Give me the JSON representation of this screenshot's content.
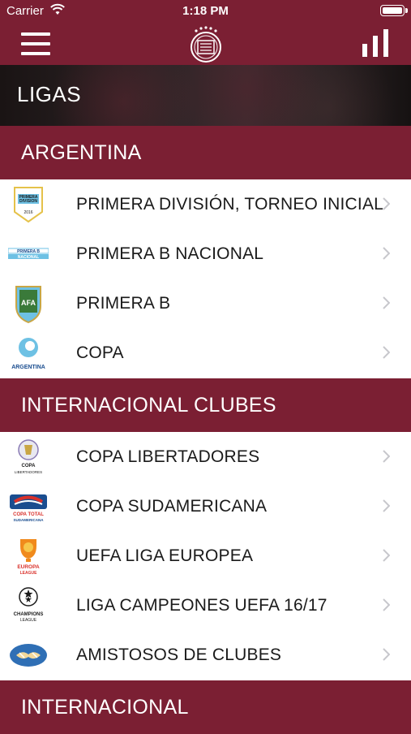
{
  "status_bar": {
    "carrier": "Carrier",
    "time": "1:18 PM"
  },
  "nav": {
    "menu_icon": "hamburger-menu-icon",
    "logo": "club-crest-logo",
    "stats_icon": "bar-chart-icon"
  },
  "hero": {
    "title": "LIGAS"
  },
  "sections": [
    {
      "title": "ARGENTINA",
      "items": [
        {
          "label": "PRIMERA DIVISIÓN, TORNEO INICIAL",
          "logo_text": "PRIMERA DIVISION",
          "logo_sub": "2016"
        },
        {
          "label": "PRIMERA B NACIONAL",
          "logo_text": "PRIMERA B",
          "logo_sub": "NACIONAL"
        },
        {
          "label": "PRIMERA B",
          "logo_text": "AFA",
          "logo_sub": ""
        },
        {
          "label": "COPA",
          "logo_text": "ARGENTINA",
          "logo_sub": ""
        }
      ]
    },
    {
      "title": "INTERNACIONAL CLUBES",
      "items": [
        {
          "label": "COPA LIBERTADORES",
          "logo_text": "COPA",
          "logo_sub": "LIBERTADORES"
        },
        {
          "label": "COPA SUDAMERICANA",
          "logo_text": "COPA TOTAL",
          "logo_sub": "SUDAMERICANA"
        },
        {
          "label": "UEFA LIGA EUROPEA",
          "logo_text": "EUROPA",
          "logo_sub": "LEAGUE"
        },
        {
          "label": "LIGA CAMPEONES UEFA 16/17",
          "logo_text": "CHAMPIONS",
          "logo_sub": "LEAGUE"
        },
        {
          "label": "AMISTOSOS DE CLUBES",
          "logo_text": "",
          "logo_sub": ""
        }
      ]
    },
    {
      "title": "INTERNACIONAL",
      "items": []
    }
  ],
  "colors": {
    "primary": "#7b1f33",
    "text": "#1a1a1a",
    "chevron": "#c7c7cc"
  }
}
